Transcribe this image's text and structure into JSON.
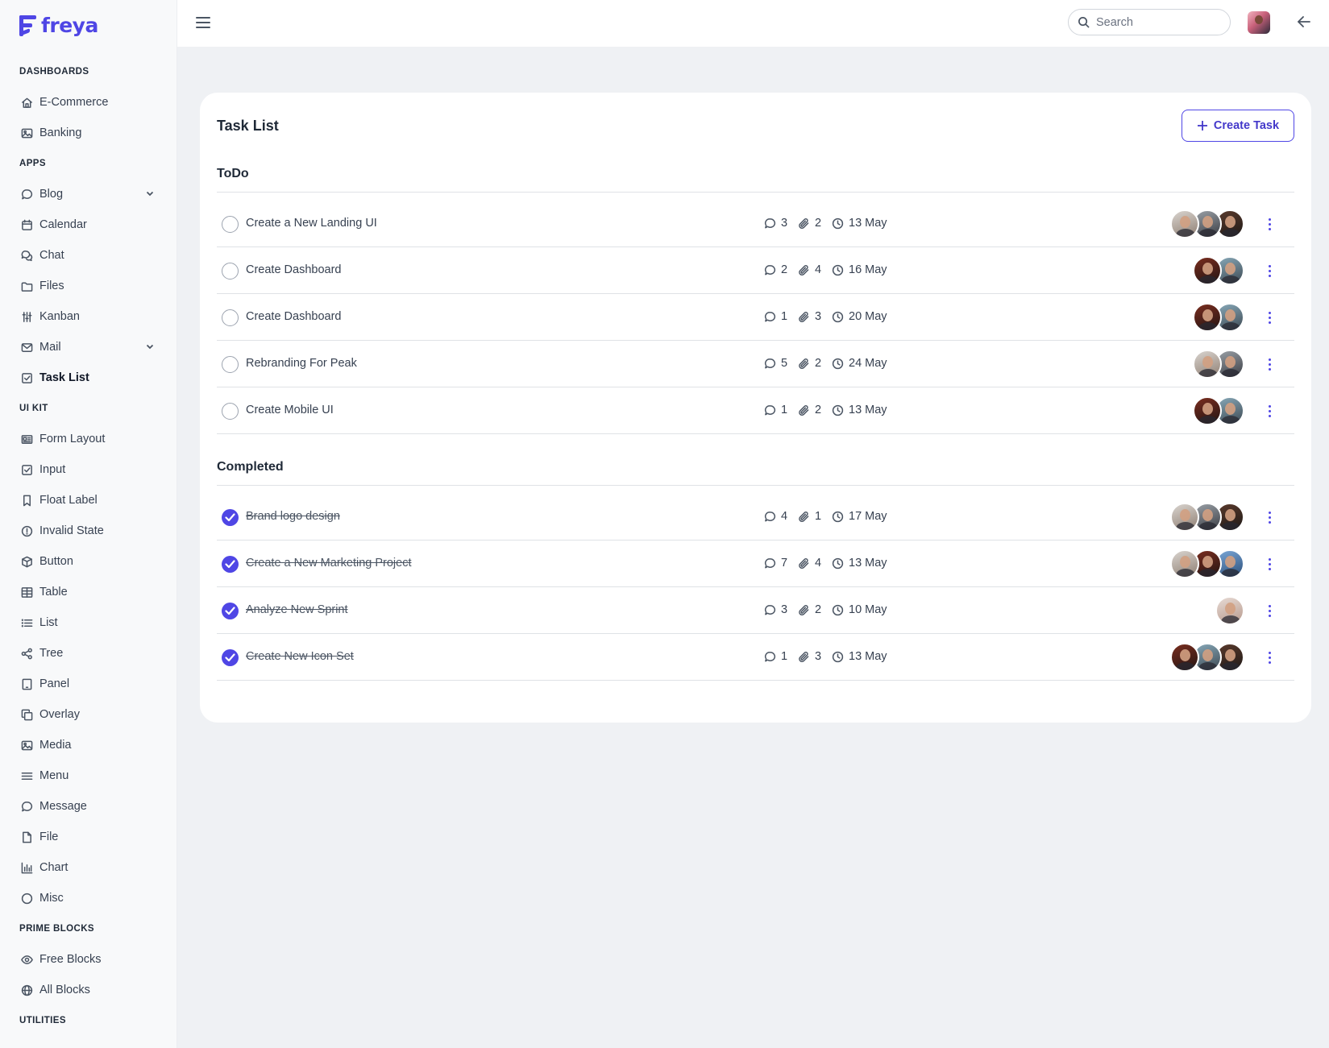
{
  "brand": {
    "name": "freya",
    "color": "#4f46e5"
  },
  "topbar": {
    "search_placeholder": "Search",
    "menu_icon": "hamburger-icon",
    "back_icon": "arrow-left-icon"
  },
  "sidebar": {
    "sections": [
      {
        "title": "DASHBOARDS",
        "items": [
          {
            "label": "E-Commerce",
            "icon": "home-icon"
          },
          {
            "label": "Banking",
            "icon": "image-icon"
          }
        ]
      },
      {
        "title": "APPS",
        "items": [
          {
            "label": "Blog",
            "icon": "comment-icon",
            "expandable": true
          },
          {
            "label": "Calendar",
            "icon": "calendar-icon"
          },
          {
            "label": "Chat",
            "icon": "comments-icon"
          },
          {
            "label": "Files",
            "icon": "folder-icon"
          },
          {
            "label": "Kanban",
            "icon": "sliders-icon"
          },
          {
            "label": "Mail",
            "icon": "envelope-icon",
            "expandable": true
          },
          {
            "label": "Task List",
            "icon": "check-square-icon",
            "active": true
          }
        ]
      },
      {
        "title": "UI KIT",
        "items": [
          {
            "label": "Form Layout",
            "icon": "id-card-icon"
          },
          {
            "label": "Input",
            "icon": "check-square-icon"
          },
          {
            "label": "Float Label",
            "icon": "bookmark-icon"
          },
          {
            "label": "Invalid State",
            "icon": "exclamation-circle-icon"
          },
          {
            "label": "Button",
            "icon": "box-icon"
          },
          {
            "label": "Table",
            "icon": "table-icon"
          },
          {
            "label": "List",
            "icon": "list-icon"
          },
          {
            "label": "Tree",
            "icon": "share-icon"
          },
          {
            "label": "Panel",
            "icon": "tablet-icon"
          },
          {
            "label": "Overlay",
            "icon": "clone-icon"
          },
          {
            "label": "Media",
            "icon": "image-icon"
          },
          {
            "label": "Menu",
            "icon": "bars-icon"
          },
          {
            "label": "Message",
            "icon": "comment-icon"
          },
          {
            "label": "File",
            "icon": "file-icon"
          },
          {
            "label": "Chart",
            "icon": "chart-bar-icon"
          },
          {
            "label": "Misc",
            "icon": "circle-icon"
          }
        ]
      },
      {
        "title": "PRIME BLOCKS",
        "items": [
          {
            "label": "Free Blocks",
            "icon": "eye-icon"
          },
          {
            "label": "All Blocks",
            "icon": "globe-icon"
          }
        ]
      },
      {
        "title": "UTILITIES",
        "items": []
      }
    ]
  },
  "main": {
    "title": "Task List",
    "create_label": "Create Task",
    "groups": [
      {
        "title": "ToDo",
        "tasks": [
          {
            "name": "Create a New Landing UI",
            "comments": "3",
            "attachments": "2",
            "date": "13 May",
            "done": false,
            "avatars": [
              "av-a",
              "av-b",
              "av-c"
            ]
          },
          {
            "name": "Create Dashboard",
            "comments": "2",
            "attachments": "4",
            "date": "16 May",
            "done": false,
            "avatars": [
              "av-d",
              "av-e"
            ]
          },
          {
            "name": "Create Dashboard",
            "comments": "1",
            "attachments": "3",
            "date": "20 May",
            "done": false,
            "avatars": [
              "av-d",
              "av-e"
            ]
          },
          {
            "name": "Rebranding For Peak",
            "comments": "5",
            "attachments": "2",
            "date": "24 May",
            "done": false,
            "avatars": [
              "av-a",
              "av-b"
            ]
          },
          {
            "name": "Create Mobile UI",
            "comments": "1",
            "attachments": "2",
            "date": "13 May",
            "done": false,
            "avatars": [
              "av-d",
              "av-e"
            ]
          }
        ]
      },
      {
        "title": "Completed",
        "tasks": [
          {
            "name": "Brand logo design",
            "comments": "4",
            "attachments": "1",
            "date": "17 May",
            "done": true,
            "avatars": [
              "av-a",
              "av-b",
              "av-c"
            ]
          },
          {
            "name": "Create a New Marketing Project",
            "comments": "7",
            "attachments": "4",
            "date": "13 May",
            "done": true,
            "avatars": [
              "av-a",
              "av-d",
              "av-f"
            ]
          },
          {
            "name": "Analyze New Sprint",
            "comments": "3",
            "attachments": "2",
            "date": "10 May",
            "done": true,
            "avatars": [
              "av-g"
            ]
          },
          {
            "name": "Create New Icon Set",
            "comments": "1",
            "attachments": "3",
            "date": "13 May",
            "done": true,
            "avatars": [
              "av-d",
              "av-e",
              "av-c"
            ]
          }
        ]
      }
    ]
  }
}
